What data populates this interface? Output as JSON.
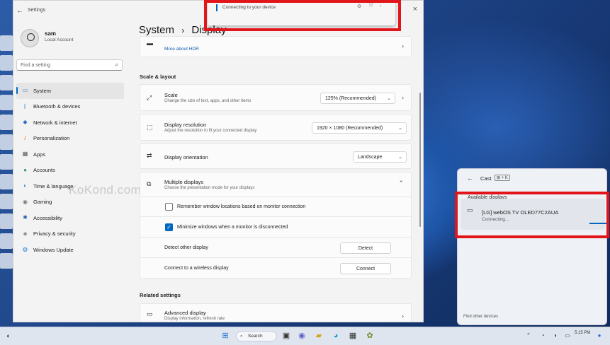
{
  "window": {
    "title": "Settings",
    "close": "×"
  },
  "profile": {
    "name": "sam",
    "type": "Local Account"
  },
  "search": {
    "placeholder": "Find a setting"
  },
  "nav": [
    {
      "label": "System",
      "icon": "monitor-icon",
      "glyph": "▭",
      "color": "#2f6fbf"
    },
    {
      "label": "Bluetooth & devices",
      "icon": "bluetooth-icon",
      "glyph": "ᛒ",
      "color": "#1f7fd6"
    },
    {
      "label": "Network & internet",
      "icon": "wifi-icon",
      "glyph": "◆",
      "color": "#2a6fc9"
    },
    {
      "label": "Personalization",
      "icon": "brush-icon",
      "glyph": "/",
      "color": "#c86d1b"
    },
    {
      "label": "Apps",
      "icon": "apps-icon",
      "glyph": "▦",
      "color": "#555555"
    },
    {
      "label": "Accounts",
      "icon": "person-icon",
      "glyph": "●",
      "color": "#2b9c6a"
    },
    {
      "label": "Time & language",
      "icon": "globe-icon",
      "glyph": "◐",
      "color": "#2a7fc0"
    },
    {
      "label": "Gaming",
      "icon": "controller-icon",
      "glyph": "◉",
      "color": "#777777"
    },
    {
      "label": "Accessibility",
      "icon": "accessibility-icon",
      "glyph": "✱",
      "color": "#1f5fa8"
    },
    {
      "label": "Privacy & security",
      "icon": "shield-icon",
      "glyph": "◈",
      "color": "#777777"
    },
    {
      "label": "Windows Update",
      "icon": "update-icon",
      "glyph": "◍",
      "color": "#1f7fd6"
    }
  ],
  "watermark": "KoKond.com",
  "breadcrumb": {
    "parent": "System",
    "separator": "›",
    "current": "Display"
  },
  "hdr": {
    "link": "More about HDR"
  },
  "scale_layout_label": "Scale & layout",
  "scale": {
    "title": "Scale",
    "sub": "Change the size of text, apps, and other items",
    "value": "125% (Recommended)"
  },
  "resolution": {
    "title": "Display resolution",
    "sub": "Adjust the resolution to fit your connected display",
    "value": "1920 × 1080 (Recommended)"
  },
  "orientation": {
    "title": "Display orientation",
    "value": "Landscape"
  },
  "multiple": {
    "title": "Multiple displays",
    "sub": "Choose the presentation mode for your displays"
  },
  "remember": {
    "label": "Remember window locations based on monitor connection",
    "checked": false
  },
  "minimize": {
    "label": "Minimize windows when a monitor is disconnected",
    "checked": true
  },
  "detect": {
    "label": "Detect other display",
    "button": "Detect"
  },
  "wireless": {
    "label": "Connect to a wireless display",
    "button": "Connect"
  },
  "related_label": "Related settings",
  "advanced": {
    "title": "Advanced display",
    "sub": "Display information, refresh rate"
  },
  "notification": {
    "text": "Connecting to your device"
  },
  "cast": {
    "title": "Cast",
    "shortcut": "⊞ + K",
    "section": "Available displays",
    "device": "[LG] webOS TV OLED77C2AUA",
    "status": "Connecting...",
    "find_other": "Find other devices"
  },
  "taskbar": {
    "search": "Search",
    "time": "5:15 PM"
  }
}
